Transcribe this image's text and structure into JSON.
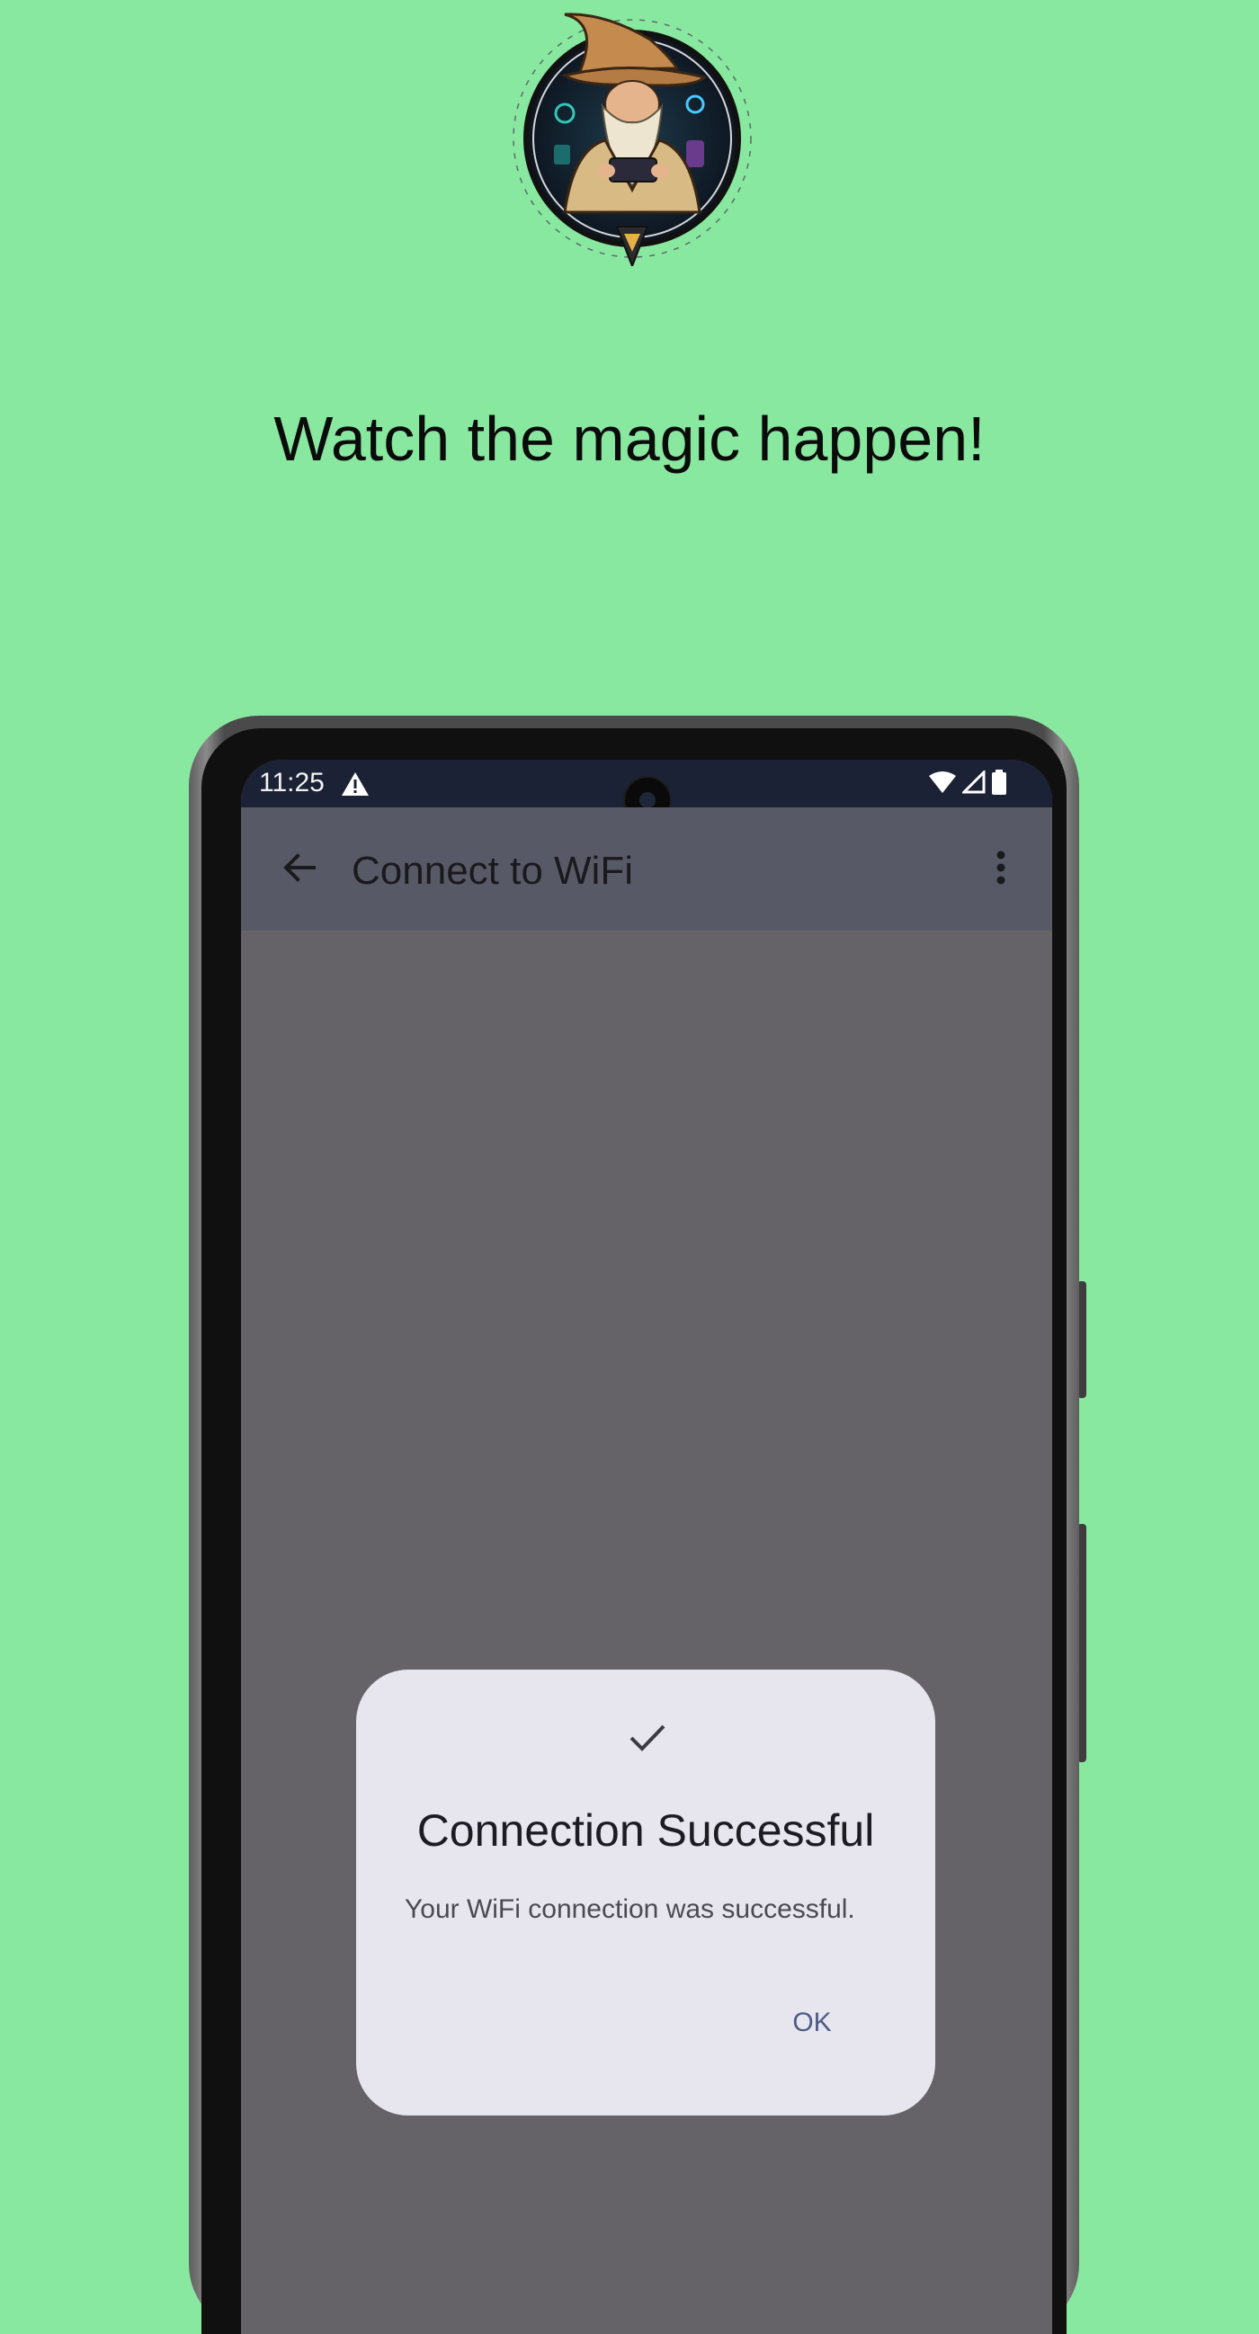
{
  "headline": "Watch the magic happen!",
  "status_bar": {
    "time": "11:25",
    "icons": [
      "warning-icon",
      "wifi-icon",
      "cell-signal-icon",
      "battery-icon"
    ]
  },
  "app_bar": {
    "title": "Connect to WiFi",
    "back_icon": "back-arrow-icon",
    "menu_icon": "more-vert-icon"
  },
  "dialog": {
    "icon": "check-icon",
    "title": "Connection Successful",
    "message": "Your WiFi connection was successful.",
    "ok_label": "OK"
  },
  "colors": {
    "page_background": "#88e89f",
    "status_bar": "#1c2236",
    "app_bar": "#575a66",
    "scrim": "#656368",
    "dialog_surface": "#e7e6ee",
    "dialog_action": "#4e5b86"
  }
}
